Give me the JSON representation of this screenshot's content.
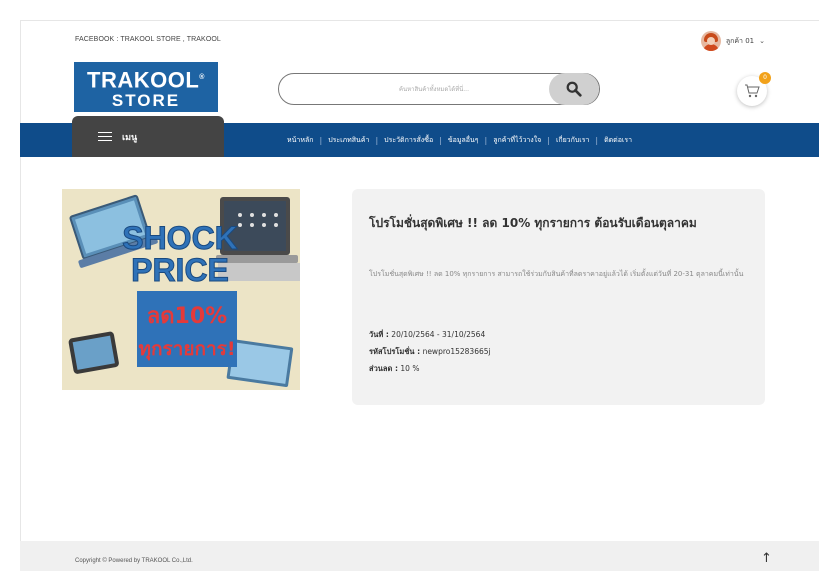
{
  "topbar": {
    "social_text": "FACEBOOK : TRAKOOL STORE , TRAKOOL",
    "user_name": "ลูกค้า 01",
    "user_chevron": "⌄"
  },
  "header": {
    "logo_line1": "TRAKOOL",
    "logo_reg": "®",
    "logo_line2": "STORE",
    "search_placeholder": "ค้นหาสินค้าทั้งหมดได้ที่นี่...",
    "cart_count": "0"
  },
  "nav": {
    "menu_label": "เมนู",
    "items": [
      {
        "label": "หน้าหลัก"
      },
      {
        "label": "ประเภทสินค้า"
      },
      {
        "label": "ประวัติการสั่งซื้อ"
      },
      {
        "label": "ข้อมูลอื่นๆ"
      },
      {
        "label": "ลูกค้าที่ไว้วางใจ"
      },
      {
        "label": "เกี่ยวกับเรา"
      },
      {
        "label": "ติดต่อเรา"
      }
    ],
    "separator": "|"
  },
  "promo_image": {
    "line1": "SHOCK",
    "line2": "PRICE",
    "line3": "ลด10%",
    "line4": "ทุกรายการ!"
  },
  "promo": {
    "title": "โปรโมชั่นสุดพิเศษ !! ลด 10% ทุกรายการ ต้อนรับเดือนตุลาคม",
    "description": "โปรโมชั่นสุดพิเศษ !! ลด 10% ทุกรายการ สามารถใช้ร่วมกับสินค้าที่ลดราคาอยู่แล้วได้ เริ่มตั้งแต่วันที่ 20-31 ตุลาคมนี้เท่านั้น",
    "date_label": "วันที่ :",
    "date_value": "20/10/2564 - 31/10/2564",
    "code_label": "รหัสโปรโมชั่น :",
    "code_value": "newpro15283665j",
    "discount_label": "ส่วนลด :",
    "discount_value": "10 %"
  },
  "footer": {
    "copyright": "Copyright © Powered by TRAKOOL Co.,Ltd.",
    "back_to_top": "↑"
  },
  "colors": {
    "nav_blue": "#0f4c8a",
    "logo_blue": "#1e63a3",
    "menu_dark": "#444444",
    "badge_orange": "#f2a21b",
    "promo_blue": "#2f72b8",
    "promo_red": "#e43a3a"
  }
}
